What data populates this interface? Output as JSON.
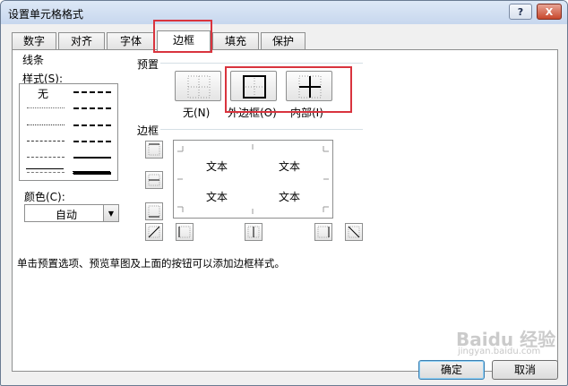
{
  "window": {
    "title": "设置单元格格式",
    "help_glyph": "?",
    "close_glyph": "X"
  },
  "tabs": [
    {
      "label": "数字"
    },
    {
      "label": "对齐"
    },
    {
      "label": "字体"
    },
    {
      "label": "边框",
      "active": true
    },
    {
      "label": "填充"
    },
    {
      "label": "保护"
    }
  ],
  "line": {
    "group_label": "线条",
    "style_label": "样式(S):",
    "none_label": "无",
    "color_label": "颜色(C):",
    "color_value": "自动"
  },
  "presets": {
    "group_label": "预置",
    "none_label": "无(N)",
    "outline_label": "外边框(O)",
    "inside_label": "内部(I)"
  },
  "border": {
    "group_label": "边框",
    "preview_text": [
      "文本",
      "文本",
      "文本",
      "文本"
    ]
  },
  "hint": "单击预置选项、预览草图及上面的按钮可以添加边框样式。",
  "buttons": {
    "ok": "确定",
    "cancel": "取消"
  },
  "watermark": {
    "text": "Baidu 经验",
    "sub": "jingyan.baidu.com"
  },
  "colors": {
    "highlight": "#d9343e",
    "accent": "#3c7fb1"
  }
}
